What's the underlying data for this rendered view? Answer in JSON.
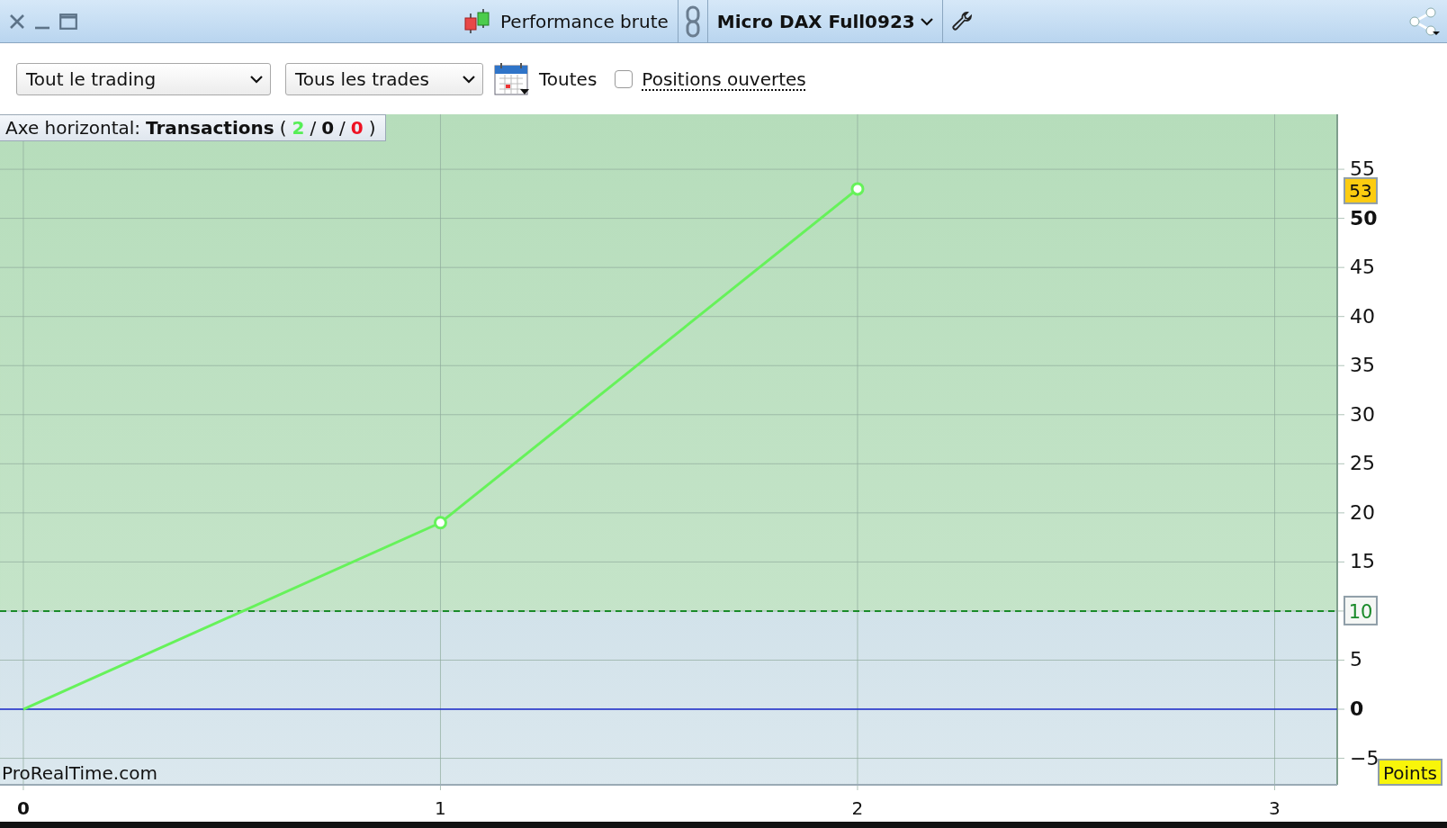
{
  "window": {
    "title": "Performance brute",
    "instrument": "Micro DAX Full0923"
  },
  "toolbar": {
    "scope": "Tout le trading",
    "trades": "Tous les trades",
    "period": "Toutes",
    "open_positions": {
      "label": "Positions ouvertes",
      "checked": false
    }
  },
  "chart": {
    "header": {
      "label": "Axe horizontal:",
      "metric": "Transactions",
      "open": "(",
      "separator": "/",
      "close": ")",
      "counts": [
        {
          "value": "2",
          "color": "#55ee55"
        },
        {
          "value": "0",
          "color": "#111111"
        },
        {
          "value": "0",
          "color": "#ee1122"
        }
      ]
    },
    "source_label": "ProRealTime.com",
    "chart_data": {
      "type": "line",
      "ylabel": "Points",
      "x": [
        0,
        1,
        2
      ],
      "series": [
        {
          "color": "#66f25a",
          "values": [
            0,
            19,
            53
          ]
        }
      ],
      "xlim": [
        -0.056,
        3.15
      ],
      "ylim": [
        -7.7,
        60.6
      ],
      "xticks": [
        0,
        1,
        2,
        3
      ],
      "yticks": [
        {
          "value": -5,
          "label": "−5"
        },
        0,
        5,
        10,
        15,
        20,
        25,
        30,
        35,
        40,
        45,
        50,
        55
      ],
      "grid": true,
      "bands": [
        {
          "axis": "y",
          "from": 10,
          "to": 60.6,
          "color": "#b6ddbb"
        },
        {
          "axis": "y",
          "from": -7.7,
          "to": 10,
          "color": "#d2e2ea"
        }
      ],
      "ref_lines": [
        {
          "axis": "y",
          "value": 10,
          "label": "10",
          "color": "#1a8a2a"
        },
        {
          "axis": "y",
          "value": 0,
          "color": "#1d2ad0"
        }
      ],
      "annotations": [
        "53"
      ]
    }
  }
}
